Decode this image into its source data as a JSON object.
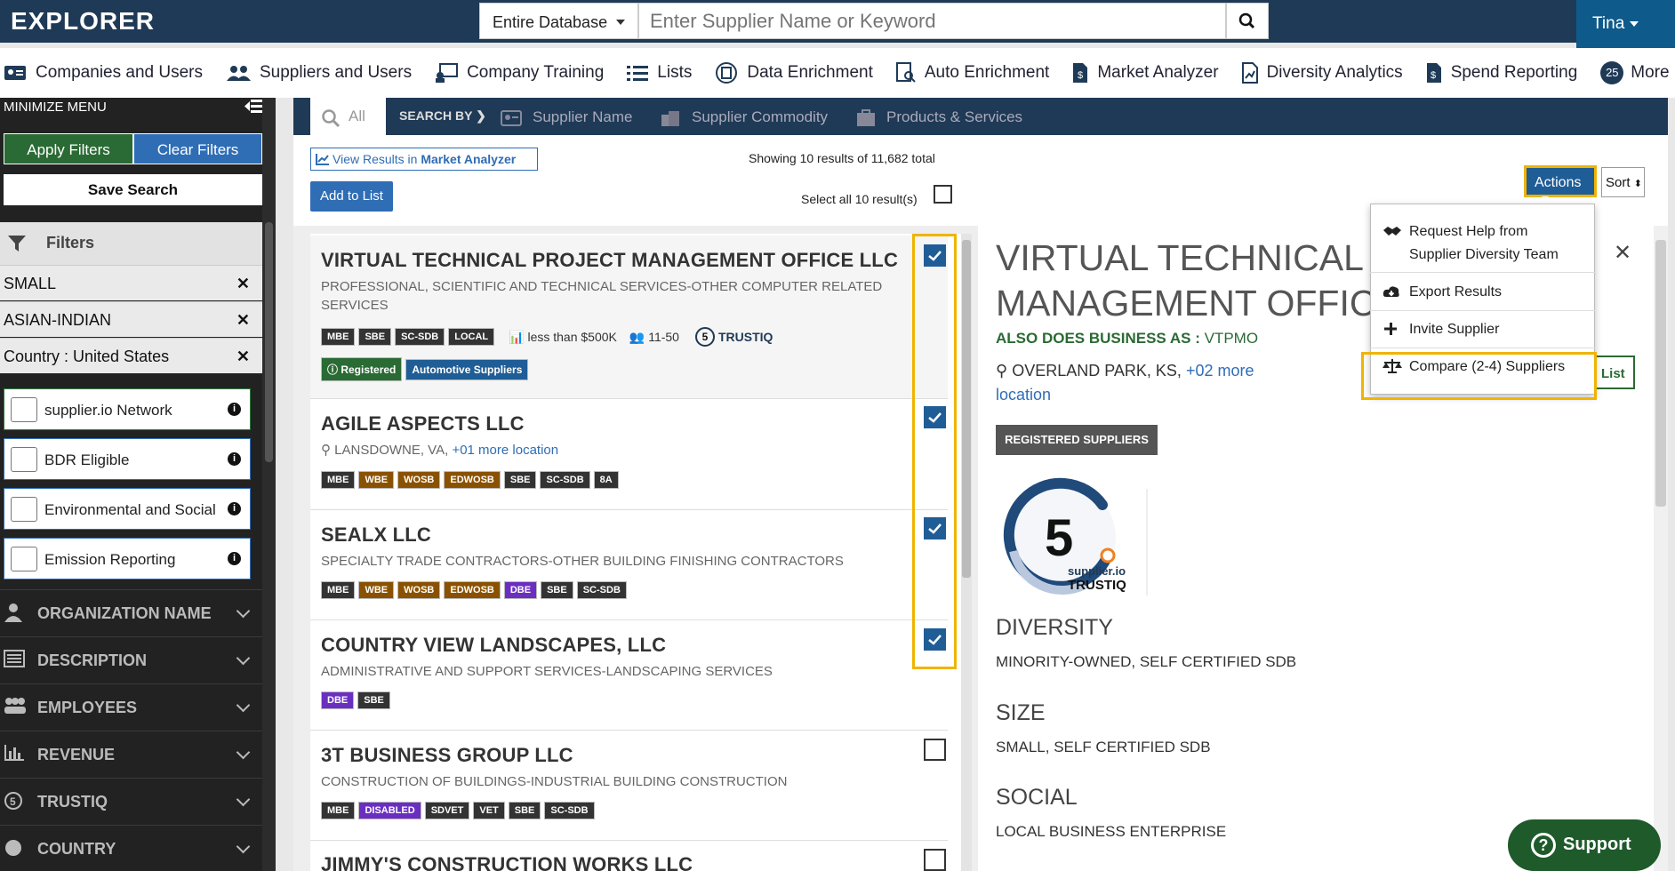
{
  "header": {
    "logo": "EXPLORER",
    "scope": "Entire Database",
    "search_placeholder": "Enter Supplier Name or Keyword",
    "user": "Tina"
  },
  "nav": [
    {
      "label": "Companies and Users",
      "icon": "id-card-icon"
    },
    {
      "label": "Suppliers and Users",
      "icon": "users-icon"
    },
    {
      "label": "Company Training",
      "icon": "presentation-icon"
    },
    {
      "label": "Lists",
      "icon": "list-icon"
    },
    {
      "label": "Data Enrichment",
      "icon": "data-enrichment-icon"
    },
    {
      "label": "Auto Enrichment",
      "icon": "auto-enrichment-icon"
    },
    {
      "label": "Market Analyzer",
      "icon": "market-analyzer-icon"
    },
    {
      "label": "Diversity Analytics",
      "icon": "diversity-analytics-icon"
    },
    {
      "label": "Spend Reporting",
      "icon": "spend-reporting-icon"
    },
    {
      "label": "More",
      "icon": "more-icon",
      "badge": "25"
    }
  ],
  "sidebar": {
    "minimize": "MINIMIZE MENU",
    "apply": "Apply Filters",
    "clear": "Clear Filters",
    "save": "Save Search",
    "filters_title": "Filters",
    "chips": [
      "SMALL",
      "ASIAN-INDIAN",
      "Country : United States"
    ],
    "checks": [
      "supplier.io Network",
      "BDR Eligible",
      "Environmental and Social",
      "Emission Reporting"
    ],
    "sections": [
      "ORGANIZATION NAME",
      "DESCRIPTION",
      "EMPLOYEES",
      "REVENUE",
      "TRUSTIQ",
      "COUNTRY"
    ]
  },
  "search_tabs": {
    "all": "All",
    "search_by": "SEARCH BY",
    "tabs": [
      "Supplier Name",
      "Supplier Commodity",
      "Products & Services"
    ]
  },
  "toolbar": {
    "view_results": "View Results in",
    "market_analyzer": "Market Analyzer",
    "showing": "Showing 10 results of 11,682 total",
    "add_to_list": "Add to List",
    "select_all": "Select all 10 result(s)",
    "actions": "Actions",
    "sort": "Sort"
  },
  "results": [
    {
      "name": "VIRTUAL TECHNICAL PROJECT MANAGEMENT OFFICE LLC",
      "desc": "PROFESSIONAL, SCIENTIFIC AND TECHNICAL SERVICES-OTHER COMPUTER RELATED SERVICES",
      "tags": [
        "MBE",
        "SBE",
        "SC-SDB",
        "LOCAL"
      ],
      "revenue": "less than $500K",
      "employees": "11-50",
      "trust": "5",
      "trust_label": "TRUSTIQ",
      "registered": "Registered",
      "auto": "Automotive Suppliers",
      "checked": true
    },
    {
      "name": "AGILE ASPECTS LLC",
      "location": "LANSDOWNE, VA,",
      "more": "+01 more location",
      "tags": [
        "MBE",
        "WBE",
        "WOSB",
        "EDWOSB",
        "SBE",
        "SC-SDB",
        "8A"
      ],
      "checked": true
    },
    {
      "name": "SEALX LLC",
      "desc": "SPECIALTY TRADE CONTRACTORS-OTHER BUILDING FINISHING CONTRACTORS",
      "tags": [
        "MBE",
        "WBE",
        "WOSB",
        "EDWOSB",
        "DBE",
        "SBE",
        "SC-SDB"
      ],
      "checked": true
    },
    {
      "name": "COUNTRY VIEW LANDSCAPES, LLC",
      "desc": "ADMINISTRATIVE AND SUPPORT SERVICES-LANDSCAPING SERVICES",
      "tags": [
        "DBE",
        "SBE"
      ],
      "checked": true
    },
    {
      "name": "3T BUSINESS GROUP LLC",
      "desc": "CONSTRUCTION OF BUILDINGS-INDUSTRIAL BUILDING CONSTRUCTION",
      "tags": [
        "MBE",
        "DISABLED",
        "SDVET",
        "VET",
        "SBE",
        "SC-SDB"
      ],
      "checked": false
    },
    {
      "name": "JIMMY'S CONSTRUCTION WORKS LLC",
      "checked": false
    }
  ],
  "detail": {
    "title_l1": "VIRTUAL TECHNICAL",
    "title_l2": "MANAGEMENT OFFICE",
    "dba_label": "ALSO DOES BUSINESS AS :",
    "dba": "VTPMO",
    "location": "OVERLAND PARK, KS,",
    "more": "+02 more location",
    "registered": "REGISTERED SUPPLIERS",
    "trust_score": "5",
    "trust_brand": "supplier.io",
    "trust_name": "TRUSTIQ",
    "diversity_h": "DIVERSITY",
    "diversity": "MINORITY-OWNED, SELF CERTIFIED SDB",
    "size_h": "SIZE",
    "size": "SMALL, SELF CERTIFIED SDB",
    "social_h": "SOCIAL",
    "social": "LOCAL BUSINESS ENTERPRISE",
    "list_btn": "List"
  },
  "actions_menu": {
    "help1": "Request Help from",
    "help2": "Supplier Diversity Team",
    "export": "Export Results",
    "invite": "Invite Supplier",
    "compare": "Compare (2-4) Suppliers"
  },
  "support": "Support",
  "colors": {
    "navy": "#1f3a56",
    "blue": "#2f6db5",
    "green": "#2a6a34",
    "highlight": "#f0b400"
  }
}
